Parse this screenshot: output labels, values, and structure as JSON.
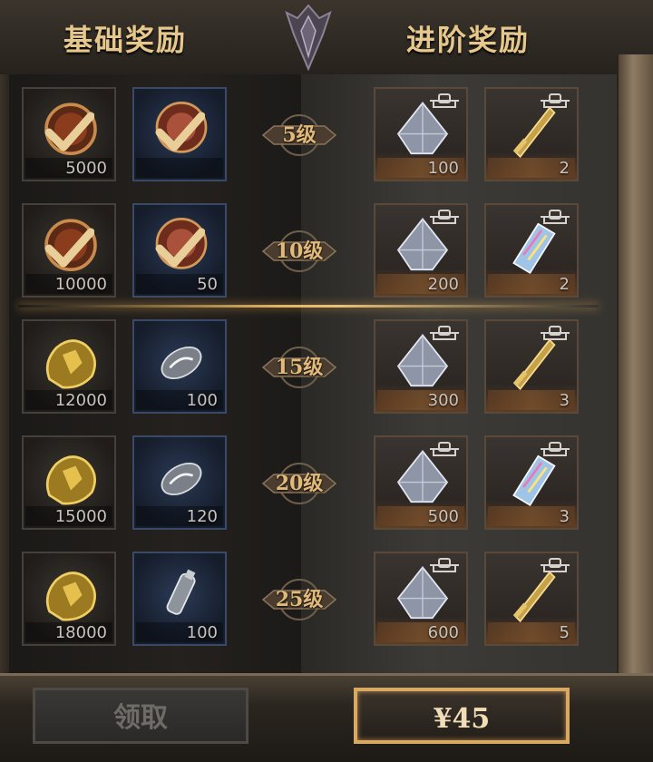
{
  "header": {
    "basic_title": "基础奖励",
    "advanced_title": "进阶奖励"
  },
  "rows": [
    {
      "level": "5级",
      "basic": [
        {
          "icon": "gold-pouch-icon",
          "count": "5000",
          "claimed": true,
          "style": "normal"
        },
        {
          "icon": "red-orb-icon",
          "count": "",
          "claimed": true,
          "style": "blue"
        }
      ],
      "advanced": [
        {
          "icon": "silver-crystal-icon",
          "count": "100",
          "locked": true
        },
        {
          "icon": "golden-sword-icon",
          "count": "2",
          "locked": true
        }
      ]
    },
    {
      "level": "10级",
      "basic": [
        {
          "icon": "gold-pouch-icon",
          "count": "10000",
          "claimed": true,
          "style": "normal"
        },
        {
          "icon": "red-orb-icon",
          "count": "50",
          "claimed": true,
          "style": "blue"
        }
      ],
      "advanced": [
        {
          "icon": "silver-crystal-icon",
          "count": "200",
          "locked": true
        },
        {
          "icon": "prism-shard-icon",
          "count": "2",
          "locked": true
        }
      ]
    },
    {
      "level": "15级",
      "basic": [
        {
          "icon": "gold-nugget-icon",
          "count": "12000",
          "claimed": false,
          "style": "normal"
        },
        {
          "icon": "silver-stone-icon",
          "count": "100",
          "claimed": false,
          "style": "blue"
        }
      ],
      "advanced": [
        {
          "icon": "silver-crystal-icon",
          "count": "300",
          "locked": true
        },
        {
          "icon": "golden-sword-icon",
          "count": "3",
          "locked": true
        }
      ]
    },
    {
      "level": "20级",
      "basic": [
        {
          "icon": "gold-nugget-icon",
          "count": "15000",
          "claimed": false,
          "style": "normal"
        },
        {
          "icon": "silver-stone-icon",
          "count": "120",
          "claimed": false,
          "style": "blue"
        }
      ],
      "advanced": [
        {
          "icon": "silver-crystal-icon",
          "count": "500",
          "locked": true
        },
        {
          "icon": "prism-shard-icon",
          "count": "3",
          "locked": true
        }
      ]
    },
    {
      "level": "25级",
      "basic": [
        {
          "icon": "gold-nugget-icon",
          "count": "18000",
          "claimed": false,
          "style": "normal"
        },
        {
          "icon": "potion-vial-icon",
          "count": "100",
          "claimed": false,
          "style": "blue"
        }
      ],
      "advanced": [
        {
          "icon": "silver-crystal-icon",
          "count": "600",
          "locked": true
        },
        {
          "icon": "golden-sword-icon",
          "count": "5",
          "locked": true
        }
      ]
    }
  ],
  "buttons": {
    "claim_label": "领取",
    "price_label": "¥45"
  },
  "colors": {
    "gold_text": "#e7c88c",
    "price_border": "#d9a862",
    "claimed_check": "#e8cf9a"
  }
}
